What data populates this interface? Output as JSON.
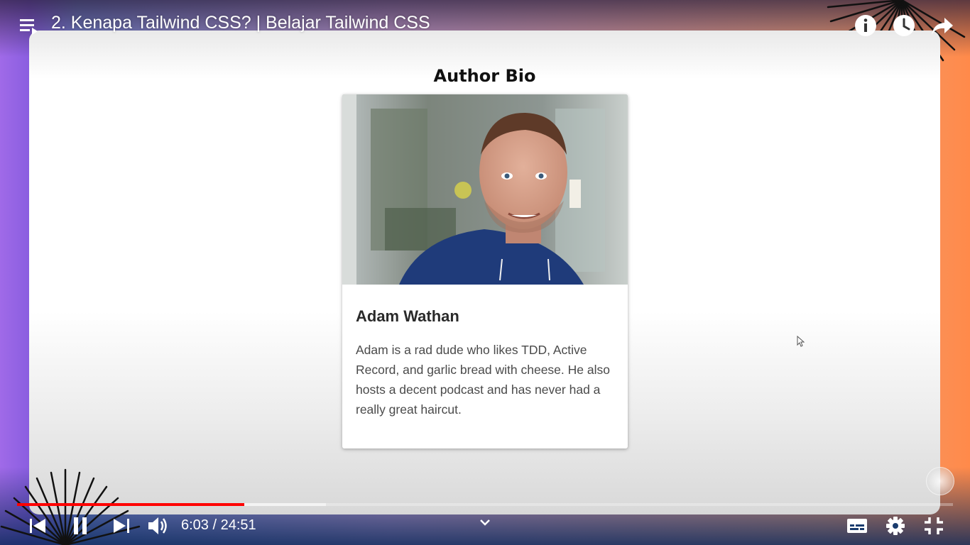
{
  "header": {
    "title": "2. Kenapa Tailwind CSS? | Belajar Tailwind CSS",
    "icons": [
      "playlist-icon",
      "info-icon",
      "watch-later-icon",
      "share-icon"
    ]
  },
  "slide": {
    "heading": "Author Bio",
    "card": {
      "name": "Adam Wathan",
      "bio": "Adam is a rad dude who likes TDD, Active Record, and garlic bread with cheese. He also hosts a decent podcast and has never had a really great haircut."
    }
  },
  "player": {
    "current_time": "6:03",
    "duration": "24:51",
    "time_display": "6:03 / 24:51",
    "played_fraction": 0.243,
    "buffered_fraction": 0.33,
    "played_color": "#ff0000",
    "controls_left": [
      "previous-icon",
      "pause-icon",
      "next-icon",
      "volume-icon"
    ],
    "controls_right": [
      "subtitles-icon",
      "settings-icon",
      "exit-fullscreen-icon"
    ]
  }
}
